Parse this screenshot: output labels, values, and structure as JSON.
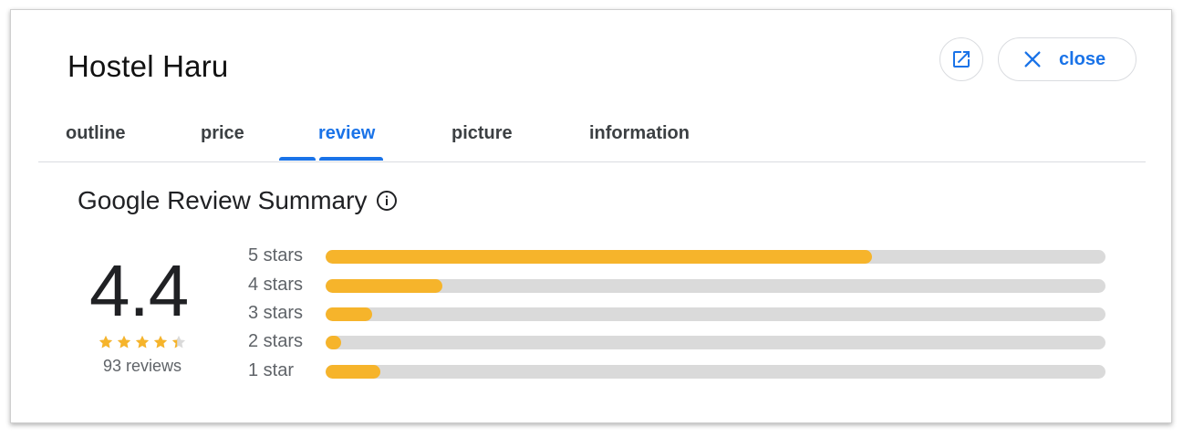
{
  "header": {
    "title": "Hostel Haru",
    "close_label": "close"
  },
  "tabs": [
    {
      "label": "outline",
      "active": false
    },
    {
      "label": "price",
      "active": false
    },
    {
      "label": "review",
      "active": true
    },
    {
      "label": "picture",
      "active": false
    },
    {
      "label": "information",
      "active": false
    }
  ],
  "summary": {
    "title": "Google Review Summary",
    "rating": "4.4",
    "stars": 4.4,
    "reviews_label": "93 reviews"
  },
  "distribution": [
    {
      "label": "5 stars",
      "fraction": 0.7
    },
    {
      "label": "4 stars",
      "fraction": 0.15
    },
    {
      "label": "3 stars",
      "fraction": 0.06
    },
    {
      "label": "2 stars",
      "fraction": 0.02
    },
    {
      "label": "1 star",
      "fraction": 0.07
    }
  ],
  "colors": {
    "accent": "#1a73e8",
    "bar_fill": "#f6b42b",
    "bar_track": "#dadada",
    "star": "#f6b42b"
  },
  "icons": {
    "open": "open-in-new-icon",
    "close": "close-icon",
    "info": "info-icon",
    "star": "star-icon"
  }
}
